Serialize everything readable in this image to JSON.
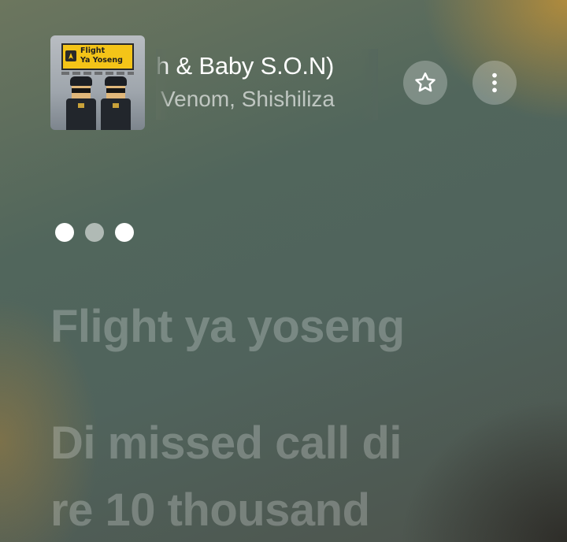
{
  "now_playing": {
    "title": "Flight Ya Yoseng (feat. Shishiliza, Venom & Baby S.O.N)",
    "title_visible": "h & Baby S.O.N)",
    "artist": "Venom, Shishiliza",
    "artwork": {
      "text": "Flight\nYa Yoseng",
      "accent_color": "#f4c418"
    }
  },
  "controls": {
    "favorite_icon": "star-outline-icon",
    "more_icon": "more-vertical-icon"
  },
  "lyrics": {
    "interlude_indicator": "three-dots",
    "lines": [
      "Flight ya yoseng",
      "Di missed call di",
      "re 10 thousand"
    ]
  },
  "colors": {
    "text_primary": "#ffffff",
    "lyrics_upcoming": "rgba(255,255,255,0.24)",
    "button_bg": "rgba(255,255,255,0.26)"
  }
}
